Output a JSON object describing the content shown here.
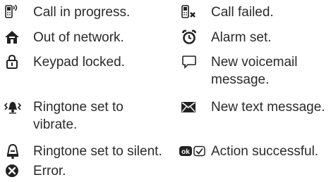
{
  "legend": {
    "left": [
      {
        "icon": "phone-signal-icon",
        "label": "Call in progress."
      },
      {
        "icon": "house-icon",
        "label": "Out of network."
      },
      {
        "icon": "padlock-icon",
        "label": "Keypad locked."
      },
      {
        "icon": "vibrate-icon",
        "label": "Ringtone set to vibrate."
      },
      {
        "icon": "bell-silent-icon",
        "label": "Ringtone set to silent."
      },
      {
        "icon": "error-icon",
        "label": "Error."
      }
    ],
    "right": [
      {
        "icon": "phone-failed-icon",
        "label": "Call failed."
      },
      {
        "icon": "alarm-clock-icon",
        "label": "Alarm set."
      },
      {
        "icon": "speech-bubble-icon",
        "label": "New voicemail message."
      },
      {
        "icon": "envelope-icon",
        "label": "New text message."
      },
      {
        "icon": "ok-check-icon",
        "label": "Action successful."
      }
    ]
  }
}
